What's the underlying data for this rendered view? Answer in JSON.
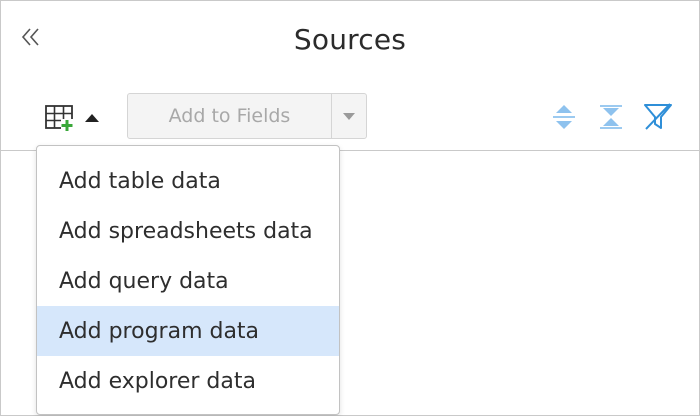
{
  "header": {
    "title": "Sources",
    "collapse_icon": "double-chevron-left-icon"
  },
  "toolbar": {
    "add_source_icon": "table-add-icon",
    "add_to_fields_label": "Add to Fields",
    "add_to_fields_enabled": false,
    "expand_all_icon": "expand-all-icon",
    "collapse_all_icon": "collapse-all-icon",
    "filter_icon": "filter-off-icon"
  },
  "menu": {
    "items": [
      {
        "label": "Add table data",
        "selected": false
      },
      {
        "label": "Add spreadsheets data",
        "selected": false
      },
      {
        "label": "Add query data",
        "selected": false
      },
      {
        "label": "Add program data",
        "selected": true
      },
      {
        "label": "Add explorer data",
        "selected": false
      }
    ]
  },
  "colors": {
    "accent_blue": "#2f8fd8",
    "light_blue": "#8ec2ee",
    "selected_bg": "#d6e7fb",
    "plus_green": "#3aa83a"
  }
}
